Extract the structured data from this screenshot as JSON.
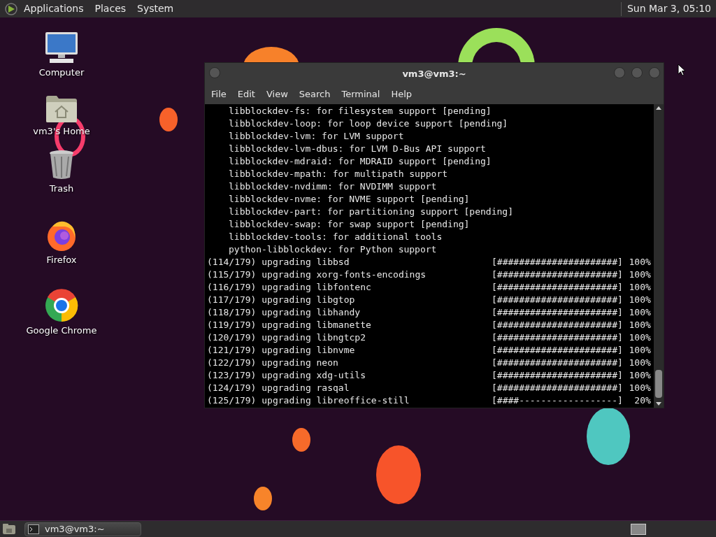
{
  "top_panel": {
    "menus": [
      "Applications",
      "Places",
      "System"
    ],
    "clock": "Sun Mar 3, 05:10"
  },
  "desktop_icons": [
    {
      "kind": "computer",
      "label": "Computer"
    },
    {
      "kind": "home",
      "label": "vm3's Home"
    },
    {
      "kind": "trash",
      "label": "Trash"
    },
    {
      "kind": "firefox",
      "label": "Firefox"
    },
    {
      "kind": "chrome",
      "label": "Google Chrome"
    }
  ],
  "terminal": {
    "title": "vm3@vm3:~",
    "menu": [
      "File",
      "Edit",
      "View",
      "Search",
      "Terminal",
      "Help"
    ],
    "lines": [
      {
        "kind": "dependency",
        "text": "libblockdev-fs: for filesystem support [pending]"
      },
      {
        "kind": "dependency",
        "text": "libblockdev-loop: for loop device support [pending]"
      },
      {
        "kind": "dependency",
        "text": "libblockdev-lvm: for LVM support"
      },
      {
        "kind": "dependency",
        "text": "libblockdev-lvm-dbus: for LVM D-Bus API support"
      },
      {
        "kind": "dependency",
        "text": "libblockdev-mdraid: for MDRAID support [pending]"
      },
      {
        "kind": "dependency",
        "text": "libblockdev-mpath: for multipath support"
      },
      {
        "kind": "dependency",
        "text": "libblockdev-nvdimm: for NVDIMM support"
      },
      {
        "kind": "dependency",
        "text": "libblockdev-nvme: for NVME support [pending]"
      },
      {
        "kind": "dependency",
        "text": "libblockdev-part: for partitioning support [pending]"
      },
      {
        "kind": "dependency",
        "text": "libblockdev-swap: for swap support [pending]"
      },
      {
        "kind": "dependency",
        "text": "libblockdev-tools: for additional tools"
      },
      {
        "kind": "dependency",
        "text": "python-libblockdev: for Python support"
      },
      {
        "kind": "progress",
        "text": "(114/179) upgrading libbsd",
        "bar": "[######################]",
        "percent": "100%"
      },
      {
        "kind": "progress",
        "text": "(115/179) upgrading xorg-fonts-encodings",
        "bar": "[######################]",
        "percent": "100%"
      },
      {
        "kind": "progress",
        "text": "(116/179) upgrading libfontenc",
        "bar": "[######################]",
        "percent": "100%"
      },
      {
        "kind": "progress",
        "text": "(117/179) upgrading libgtop",
        "bar": "[######################]",
        "percent": "100%"
      },
      {
        "kind": "progress",
        "text": "(118/179) upgrading libhandy",
        "bar": "[######################]",
        "percent": "100%"
      },
      {
        "kind": "progress",
        "text": "(119/179) upgrading libmanette",
        "bar": "[######################]",
        "percent": "100%"
      },
      {
        "kind": "progress",
        "text": "(120/179) upgrading libngtcp2",
        "bar": "[######################]",
        "percent": "100%"
      },
      {
        "kind": "progress",
        "text": "(121/179) upgrading libnvme",
        "bar": "[######################]",
        "percent": "100%"
      },
      {
        "kind": "progress",
        "text": "(122/179) upgrading neon",
        "bar": "[######################]",
        "percent": "100%"
      },
      {
        "kind": "progress",
        "text": "(123/179) upgrading xdg-utils",
        "bar": "[######################]",
        "percent": "100%"
      },
      {
        "kind": "progress",
        "text": "(124/179) upgrading rasqal",
        "bar": "[######################]",
        "percent": "100%"
      },
      {
        "kind": "progress",
        "text": "(125/179) upgrading libreoffice-still",
        "bar": "[####------------------]",
        "percent": "20%"
      }
    ]
  },
  "taskbar": {
    "tasks": [
      {
        "label": "vm3@vm3:~",
        "selected": false
      }
    ]
  }
}
